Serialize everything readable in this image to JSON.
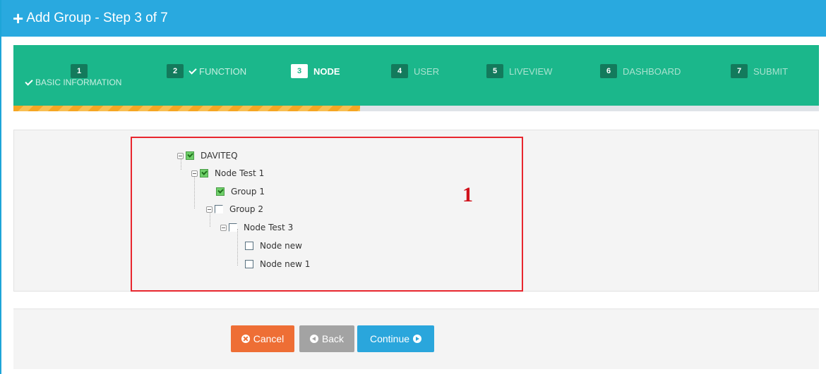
{
  "header": {
    "plus_icon": "plus-icon",
    "title": "Add Group - Step 3 of 7"
  },
  "wizard": {
    "steps": [
      {
        "number": "1",
        "label": "BASIC INFORMATION",
        "state": "done"
      },
      {
        "number": "2",
        "label": "FUNCTION",
        "state": "done"
      },
      {
        "number": "3",
        "label": "NODE",
        "state": "active"
      },
      {
        "number": "4",
        "label": "USER",
        "state": "pending"
      },
      {
        "number": "5",
        "label": "LIVEVIEW",
        "state": "pending"
      },
      {
        "number": "6",
        "label": "DASHBOARD",
        "state": "pending"
      },
      {
        "number": "7",
        "label": "SUBMIT",
        "state": "pending"
      }
    ],
    "progress_percent": 43
  },
  "tree": {
    "nodes": [
      {
        "label": "DAVITEQ",
        "checked": true
      },
      {
        "label": "Node Test 1",
        "checked": true
      },
      {
        "label": "Group 1",
        "checked": true
      },
      {
        "label": "Group 2",
        "checked": false
      },
      {
        "label": "Node Test 3",
        "checked": false
      },
      {
        "label": "Node new",
        "checked": false
      },
      {
        "label": "Node new 1",
        "checked": false
      }
    ]
  },
  "annotation": {
    "marker": "1"
  },
  "footer": {
    "cancel_label": "Cancel",
    "back_label": "Back",
    "continue_label": "Continue"
  },
  "colors": {
    "header": "#29a9df",
    "wizard": "#1bb78b",
    "progress": "#f5a623",
    "cancel": "#ee6e35",
    "back": "#a3a3a3",
    "continue": "#2aa6dc",
    "highlight": "#e8262e"
  }
}
